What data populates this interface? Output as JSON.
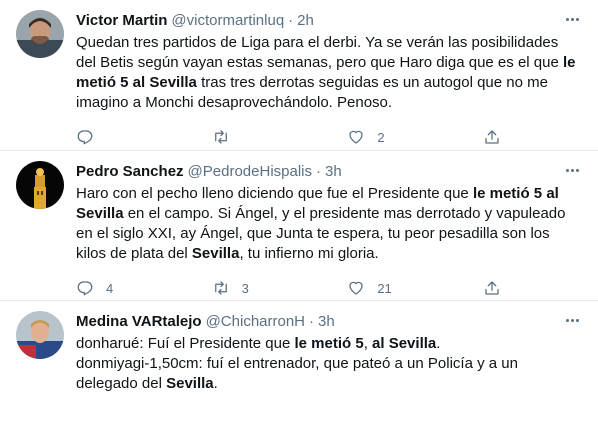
{
  "tweets": [
    {
      "display_name": "Victor Martin",
      "handle": "@victormartinluq",
      "separator": "·",
      "time": "2h",
      "text_parts": [
        "Quedan tres partidos de Liga para el derbi. Ya se verán las posibilidades del Betis según vayan estas semanas, pero que Haro diga que es el que ",
        "le metió 5 al Sevilla",
        " tras tres derrotas seguidas es un autogol que no me imagino a Monchi desaprovechándolo. Penoso."
      ],
      "replies": "",
      "retweets": "",
      "likes": "2",
      "icons": {
        "reply": "reply-icon",
        "retweet": "retweet-icon",
        "like": "heart-icon",
        "share": "share-icon",
        "more": "more-icon"
      }
    },
    {
      "display_name": "Pedro Sanchez",
      "handle": "@PedrodeHispalis",
      "separator": "·",
      "time": "3h",
      "text_parts": [
        "Haro con el pecho lleno diciendo que fue el Presidente que ",
        "le metió 5 al Sevilla",
        " en el campo. Si Ángel, y el presidente mas derrotado y vapuleado en el siglo XXI, ay Ángel, que Junta te espera, tu peor pesadilla son los kilos de plata del ",
        "Sevilla",
        ", tu infierno mi gloria."
      ],
      "replies": "4",
      "retweets": "3",
      "likes": "21"
    },
    {
      "display_name": "Medina VARtalejo",
      "handle": "@ChicharronH",
      "separator": "·",
      "time": "3h",
      "text_parts": [
        "donharué: Fuí el Presidente que ",
        "le metió 5",
        ", ",
        "al Sevilla",
        ".",
        "donmiyagi-1,50cm: fuí el entrenador, que pateó a un Policía y a un delegado del ",
        "Sevilla",
        "."
      ]
    }
  ],
  "colors": {
    "text": "#0f1419",
    "secondary": "#5b7083",
    "border": "#e6ecf0"
  }
}
